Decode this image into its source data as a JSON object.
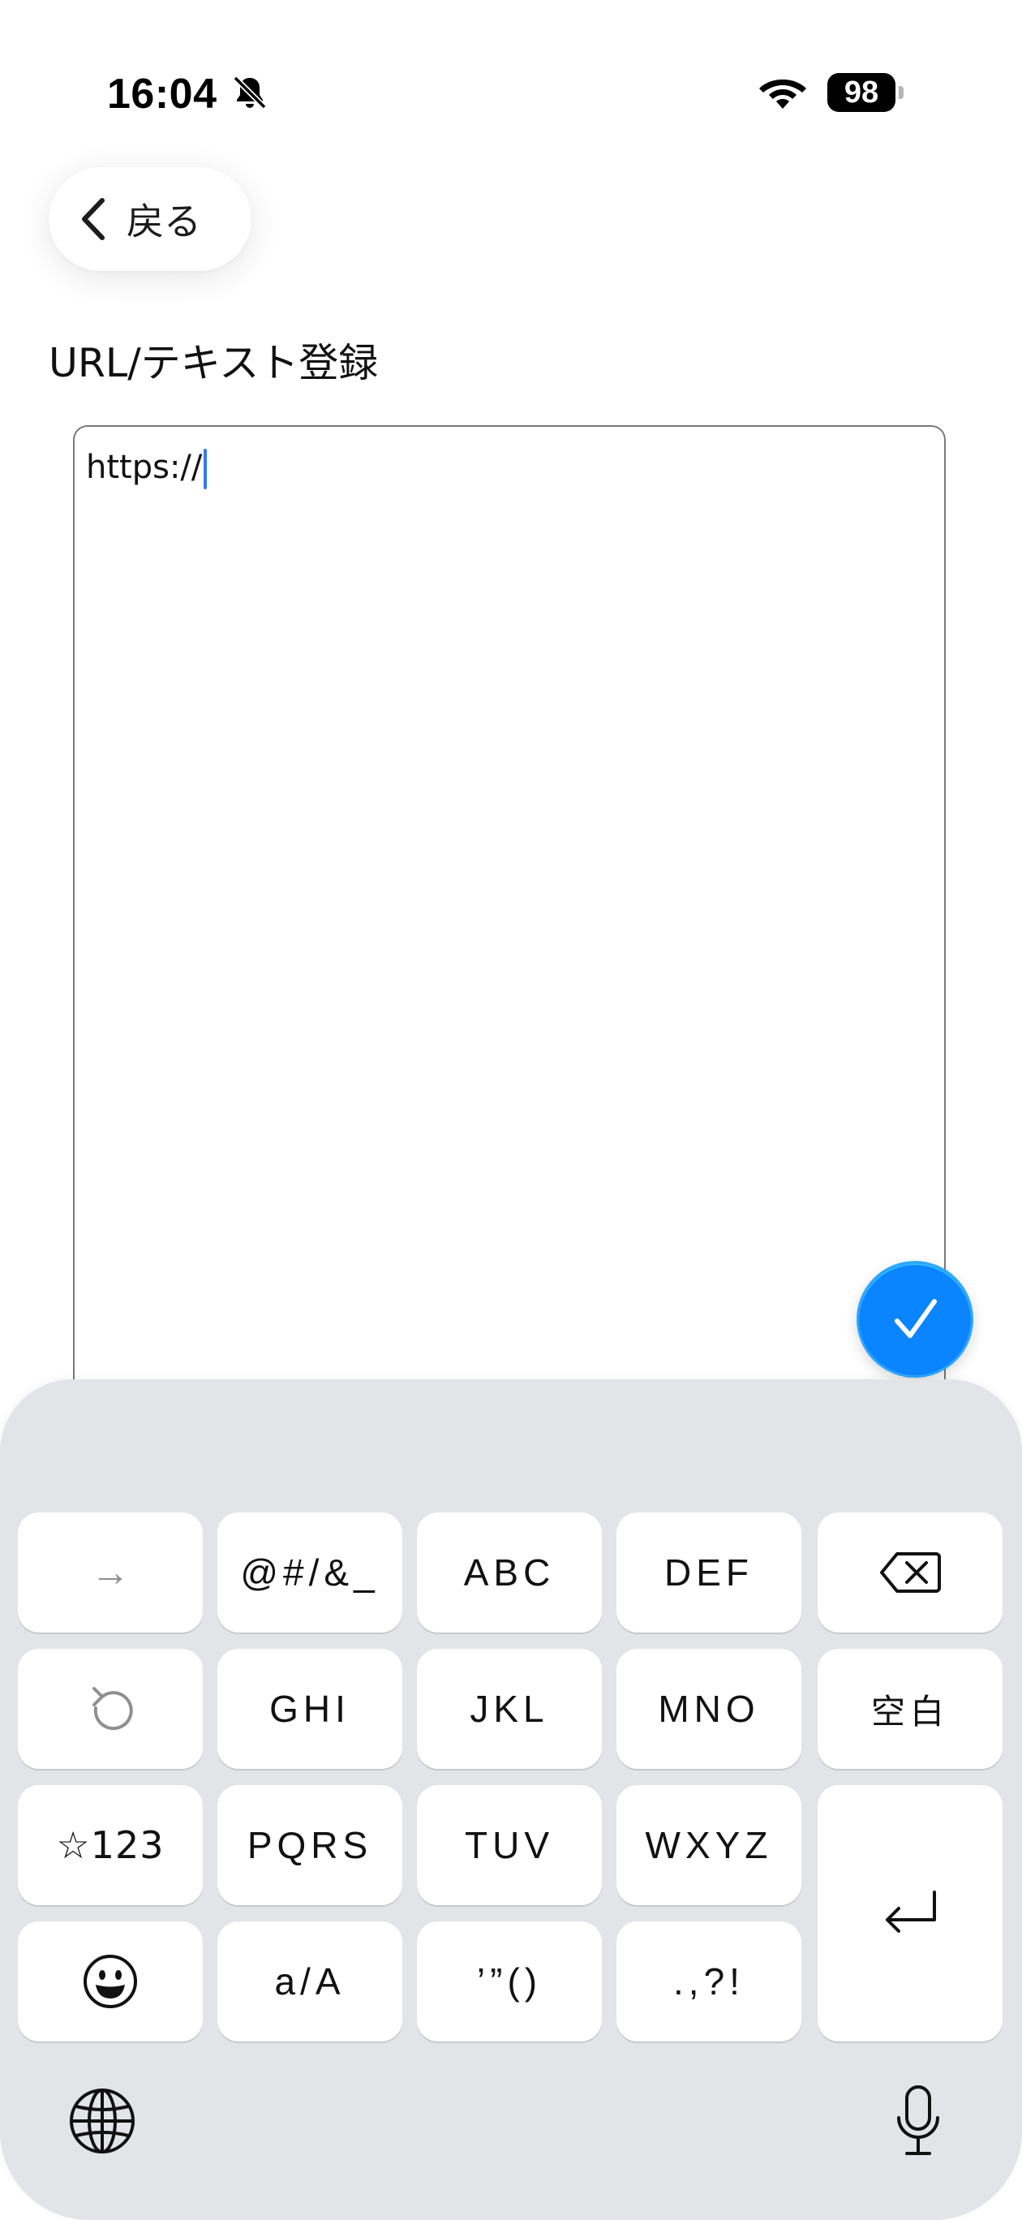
{
  "status_bar": {
    "time": "16:04",
    "battery": "98",
    "icons": [
      "bell-slash-icon",
      "wifi-icon",
      "battery-icon"
    ]
  },
  "header": {
    "back_label": "戻る",
    "back_icon": "chevron-left-icon"
  },
  "page": {
    "title": "URL/テキスト登録"
  },
  "editor": {
    "value": "https://"
  },
  "confirm": {
    "icon": "checkmark-icon",
    "color": "#0a84ff"
  },
  "keyboard": {
    "rows": [
      [
        "→",
        "@#/&_",
        "ABC",
        "DEF",
        "backspace"
      ],
      [
        "undo",
        "GHI",
        "JKL",
        "MNO",
        "空白"
      ],
      [
        "☆123",
        "PQRS",
        "TUV",
        "WXYZ",
        "return"
      ],
      [
        "emoji",
        "a/A",
        "’”()",
        ".,?!"
      ]
    ],
    "keys": {
      "arrow": "→",
      "symbols": "@#/&_",
      "abc": "ABC",
      "def": "DEF",
      "ghi": "GHI",
      "jkl": "JKL",
      "mno": "MNO",
      "space": "空白",
      "num": "☆123",
      "pqrs": "PQRS",
      "tuv": "TUV",
      "wxyz": "WXYZ",
      "case": "a/A",
      "quotes": "’”()",
      "punct": ".,?!"
    },
    "background": "#e3e4e8"
  }
}
